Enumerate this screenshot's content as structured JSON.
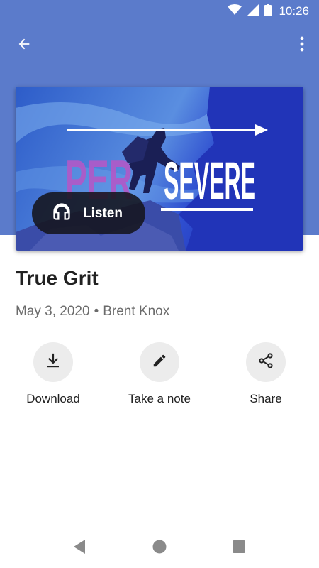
{
  "status_bar": {
    "time": "10:26",
    "icons": [
      "wifi-icon",
      "cell-signal-icon",
      "battery-icon"
    ]
  },
  "app_bar": {
    "back_icon": "arrow-back-icon",
    "more_icon": "more-vert-icon"
  },
  "colors": {
    "header_band": "#5b7bcb",
    "hero_blue": "#2a3fc0",
    "per_purple": "#b05ac8",
    "title_text": "#212121",
    "meta_text": "#6b6b6b",
    "action_circle": "#ececec"
  },
  "hero": {
    "text_left": "PER",
    "text_right": "SEVERE"
  },
  "listen_button": {
    "label": "Listen",
    "icon": "headphones-icon"
  },
  "sermon": {
    "title": "True Grit",
    "date": "May 3, 2020",
    "separator": "•",
    "speaker": "Brent Knox"
  },
  "actions": [
    {
      "label": "Download",
      "icon": "download-icon"
    },
    {
      "label": "Take a note",
      "icon": "pencil-icon"
    },
    {
      "label": "Share",
      "icon": "share-icon"
    }
  ],
  "nav_bar": {
    "icons": [
      "back-triangle-icon",
      "home-circle-icon",
      "recents-square-icon"
    ]
  }
}
